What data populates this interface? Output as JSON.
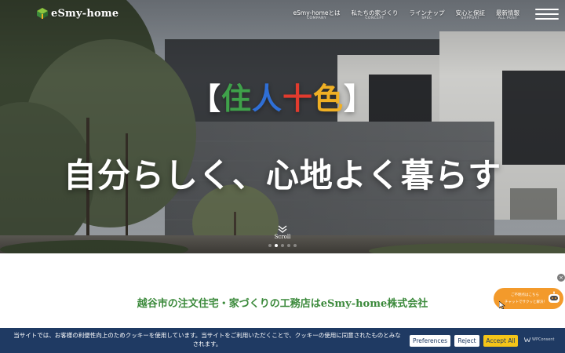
{
  "header": {
    "logo_text": "eSmy-home",
    "nav": [
      {
        "jp": "eSmy-homeとは",
        "en": "COMPANY"
      },
      {
        "jp": "私たちの家づくり",
        "en": "CONCEPT"
      },
      {
        "jp": "ラインナップ",
        "en": "SPEC"
      },
      {
        "jp": "安心と保証",
        "en": "SUPPORT"
      },
      {
        "jp": "最新情報",
        "en": "ALL POST"
      }
    ]
  },
  "hero": {
    "tagline": {
      "open": "【",
      "chars": [
        {
          "text": "住",
          "color": "#3fa14a"
        },
        {
          "text": "人",
          "color": "#2f6fd6"
        },
        {
          "text": "十",
          "color": "#e23b2e"
        },
        {
          "text": "色",
          "color": "#f0b024"
        }
      ],
      "close": "】"
    },
    "headline": "自分らしく、心地よく暮らす",
    "scroll_label": "Scroll",
    "slides_total": 5,
    "slide_active_index": 1
  },
  "main": {
    "subtitle": "越谷市の注文住宅・家づくりの工務店はeSmy-home株式会社"
  },
  "chat_widget": {
    "line1": "ご不明点はこちら",
    "line2": "チャットでサクッと解決！",
    "close_glyph": "×"
  },
  "cookie_banner": {
    "message": "当サイトでは、お客様の利便性向上のためクッキーを使用しています。当サイトをご利用いただくことで、クッキーの使用に同意されたものとみなされます。",
    "preferences_label": "Preferences",
    "reject_label": "Reject",
    "accept_label": "Accept All",
    "brand": "WPConsent"
  },
  "colors": {
    "brand_green": "#3c8a3c",
    "cookie_bg": "#1f3a63",
    "accept_yellow": "#f5c518",
    "chat_orange": "#f39a2b"
  },
  "icons": [
    "logo-mark-icon",
    "hamburger-menu-icon",
    "chevron-double-down-icon",
    "close-icon",
    "chat-bot-icon",
    "cursor-icon",
    "wpconsent-logo-icon"
  ]
}
